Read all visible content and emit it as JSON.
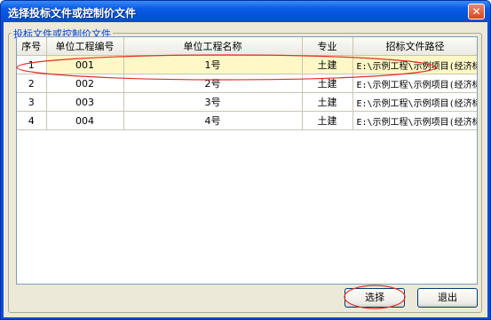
{
  "window": {
    "title": "选择投标文件或控制价文件",
    "close_glyph": "✕"
  },
  "group": {
    "label": "投标文件或控制价文件"
  },
  "table": {
    "headers": [
      "序号",
      "单位工程编号",
      "单位工程名称",
      "专业",
      "招标文件路径"
    ],
    "rows": [
      [
        "1",
        "001",
        "1号",
        "土建",
        "E:\\示例工程\\示例项目(经济标投"
      ],
      [
        "2",
        "002",
        "2号",
        "土建",
        "E:\\示例工程\\示例项目(经济标投"
      ],
      [
        "3",
        "003",
        "3号",
        "土建",
        "E:\\示例工程\\示例项目(经济标投"
      ],
      [
        "4",
        "004",
        "4号",
        "土建",
        "E:\\示例工程\\示例项目(经济标投"
      ]
    ],
    "selected_row": 1
  },
  "buttons": {
    "select": "选择",
    "exit": "退出"
  },
  "colors": {
    "title_bar": "#0a5ce8",
    "selected_row": "#fff7c6",
    "annotation": "#e0302a"
  }
}
